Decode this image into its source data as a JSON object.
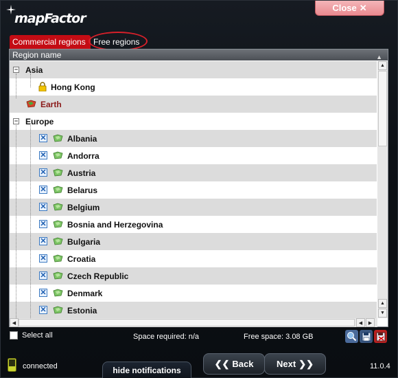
{
  "header": {
    "logo_text": "mapFactor",
    "close_label": "Close"
  },
  "tabs": [
    {
      "label": "Commercial regions",
      "active": true
    },
    {
      "label": "Free regions",
      "active": false
    }
  ],
  "list": {
    "column_header": "Region name",
    "rows": [
      {
        "label": "Asia",
        "kind": "group"
      },
      {
        "label": "Hong Kong",
        "kind": "locked"
      },
      {
        "label": "Earth",
        "kind": "earth"
      },
      {
        "label": "Europe",
        "kind": "group"
      },
      {
        "label": "Albania",
        "kind": "checked"
      },
      {
        "label": "Andorra",
        "kind": "checked"
      },
      {
        "label": "Austria",
        "kind": "checked"
      },
      {
        "label": "Belarus",
        "kind": "checked"
      },
      {
        "label": "Belgium",
        "kind": "checked"
      },
      {
        "label": "Bosnia and Herzegovina",
        "kind": "checked"
      },
      {
        "label": "Bulgaria",
        "kind": "checked"
      },
      {
        "label": "Croatia",
        "kind": "checked"
      },
      {
        "label": "Czech Republic",
        "kind": "checked"
      },
      {
        "label": "Denmark",
        "kind": "checked"
      },
      {
        "label": "Estonia",
        "kind": "checked"
      }
    ]
  },
  "footer": {
    "select_all_label": "Select all",
    "space_required": "Space required: n/a",
    "free_space": "Free space: 3.08 GB",
    "status": "connected",
    "hide_notifications": "hide notifications",
    "back_label": "Back",
    "next_label": "Next",
    "version": "11.0.4"
  },
  "colors": {
    "active_tab": "#c40c14",
    "close_button": "#e98a90",
    "highlight_oval": "#d8202a"
  }
}
